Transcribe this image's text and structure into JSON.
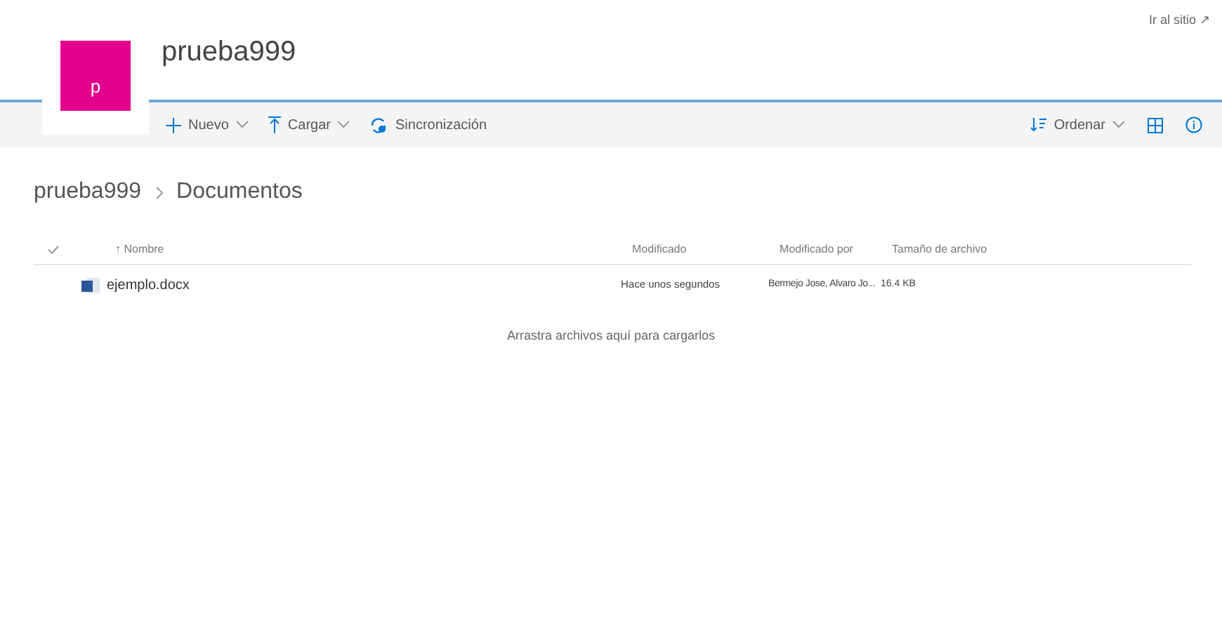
{
  "site": {
    "logo_letter": "p",
    "title": "prueba999",
    "go_to_site": "Ir al sitio ↗"
  },
  "toolbar": {
    "left": [
      {
        "kind": "new",
        "label": "Nuevo",
        "dropdown": true
      },
      {
        "kind": "upload",
        "label": "Cargar",
        "dropdown": true
      },
      {
        "kind": "sync",
        "label": "Sincronización",
        "dropdown": false
      }
    ],
    "sort": {
      "label": "Ordenar"
    }
  },
  "breadcrumb": [
    "prueba999",
    "Documentos"
  ],
  "table": {
    "sort_arrow": "↑",
    "columns": [
      "Nombre",
      "Modificado",
      "Modificado por",
      "Tamaño de archivo"
    ],
    "rows": [
      {
        "name": "ejemplo.docx",
        "modified": "Hace unos segundos",
        "modified_by": "Bermejo Jose, Alvaro Jo...",
        "size": "16.4 KB"
      }
    ]
  },
  "empty_hint": "Arrastra archivos aquí para cargarlos"
}
